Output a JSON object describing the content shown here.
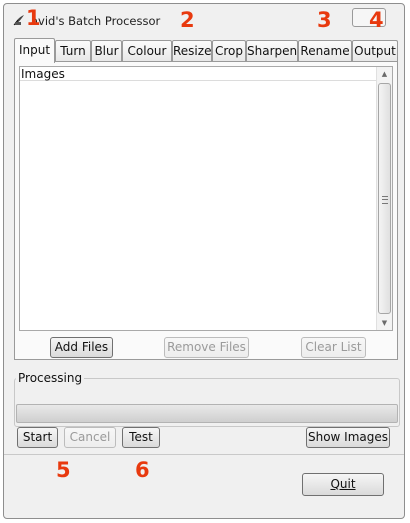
{
  "window": {
    "title": "avid's Batch Processor",
    "icon": "app-feather-icon"
  },
  "annotations": [
    "1",
    "2",
    "3",
    "4",
    "5",
    "6"
  ],
  "tabs": [
    {
      "label": "Input",
      "active": true
    },
    {
      "label": "Turn"
    },
    {
      "label": "Blur"
    },
    {
      "label": "Colour"
    },
    {
      "label": "Resize"
    },
    {
      "label": "Crop"
    },
    {
      "label": "Sharpen"
    },
    {
      "label": "Rename"
    },
    {
      "label": "Output"
    }
  ],
  "input_tab": {
    "list_header": "Images",
    "add_files": "Add Files",
    "remove_files": "Remove Files",
    "clear_list": "Clear List"
  },
  "processing": {
    "label": "Processing",
    "progress": 0
  },
  "controls": {
    "start": "Start",
    "cancel": "Cancel",
    "test": "Test",
    "show_images": "Show Images",
    "quit": "Quit"
  },
  "colors": {
    "annotation": "#e8390e",
    "window_bg": "#f0f0f0"
  }
}
